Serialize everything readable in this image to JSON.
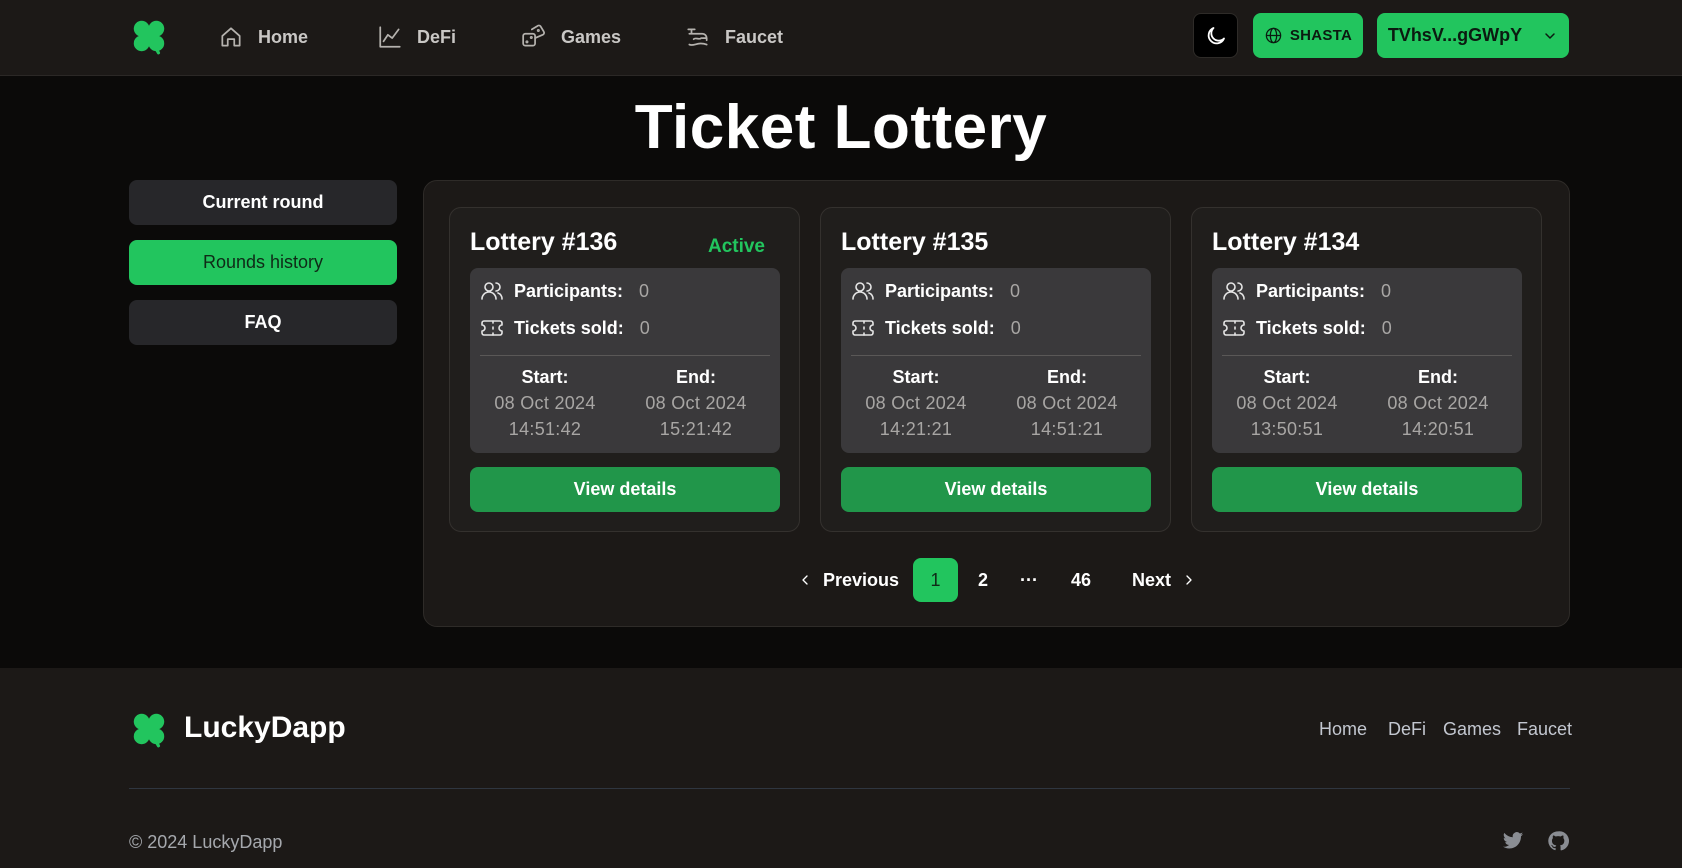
{
  "nav": {
    "items": [
      {
        "label": "Home",
        "icon": "home-icon"
      },
      {
        "label": "DeFi",
        "icon": "chart-line-icon"
      },
      {
        "label": "Games",
        "icon": "dice-icon"
      },
      {
        "label": "Faucet",
        "icon": "faucet-icon"
      }
    ],
    "network_label": "SHASTA",
    "wallet_label": "TVhsV...gGWpY"
  },
  "page_title": "Ticket Lottery",
  "sidebar": {
    "items": [
      {
        "label": "Current round",
        "active": false
      },
      {
        "label": "Rounds history",
        "active": true
      },
      {
        "label": "FAQ",
        "active": false
      }
    ]
  },
  "lotteries": [
    {
      "title": "Lottery #136",
      "status": "Active",
      "participants_label": "Participants:",
      "participants": "0",
      "tickets_label": "Tickets sold:",
      "tickets": "0",
      "start_label": "Start:",
      "start_date": "08 Oct 2024",
      "start_time": "14:51:42",
      "end_label": "End:",
      "end_date": "08 Oct 2024",
      "end_time": "15:21:42",
      "button": "View details"
    },
    {
      "title": "Lottery #135",
      "status": "",
      "participants_label": "Participants:",
      "participants": "0",
      "tickets_label": "Tickets sold:",
      "tickets": "0",
      "start_label": "Start:",
      "start_date": "08 Oct 2024",
      "start_time": "14:21:21",
      "end_label": "End:",
      "end_date": "08 Oct 2024",
      "end_time": "14:51:21",
      "button": "View details"
    },
    {
      "title": "Lottery #134",
      "status": "",
      "participants_label": "Participants:",
      "participants": "0",
      "tickets_label": "Tickets sold:",
      "tickets": "0",
      "start_label": "Start:",
      "start_date": "08 Oct 2024",
      "start_time": "13:50:51",
      "end_label": "End:",
      "end_date": "08 Oct 2024",
      "end_time": "14:20:51",
      "button": "View details"
    }
  ],
  "pagination": {
    "previous": "Previous",
    "pages": [
      "1",
      "2",
      "···",
      "46"
    ],
    "current": "1",
    "next": "Next"
  },
  "footer": {
    "brand": "LuckyDapp",
    "links": [
      "Home",
      "DeFi",
      "Games",
      "Faucet"
    ],
    "copyright": "© 2024 LuckyDapp",
    "social_icons": [
      "twitter-icon",
      "github-icon"
    ]
  },
  "colors": {
    "accent": "#22c55e",
    "button_dark_green": "#21964a",
    "background": "#0b0a09",
    "surface": "#1c1917"
  }
}
